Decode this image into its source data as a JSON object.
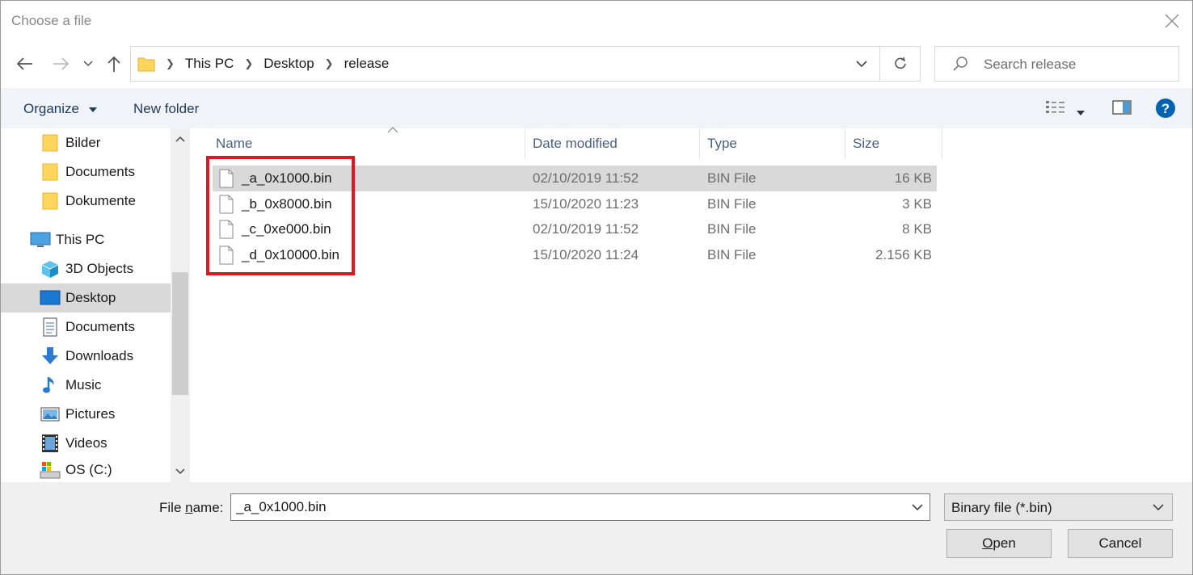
{
  "window": {
    "title": "Choose a file"
  },
  "breadcrumb": {
    "items": [
      "This PC",
      "Desktop",
      "release"
    ]
  },
  "search": {
    "placeholder": "Search release"
  },
  "toolbar": {
    "organize_label": "Organize",
    "new_folder_label": "New folder"
  },
  "sidebar": {
    "items": [
      {
        "label": "Bilder",
        "icon": "folder-icon"
      },
      {
        "label": "Documents",
        "icon": "folder-icon"
      },
      {
        "label": "Dokumente",
        "icon": "folder-icon"
      },
      {
        "label": "This PC",
        "icon": "computer-icon"
      },
      {
        "label": "3D Objects",
        "icon": "cube-icon"
      },
      {
        "label": "Desktop",
        "icon": "desktop-icon",
        "selected": true
      },
      {
        "label": "Documents",
        "icon": "documents-icon"
      },
      {
        "label": "Downloads",
        "icon": "download-icon"
      },
      {
        "label": "Music",
        "icon": "music-icon"
      },
      {
        "label": "Pictures",
        "icon": "pictures-icon"
      },
      {
        "label": "Videos",
        "icon": "video-icon"
      },
      {
        "label": "OS (C:)",
        "icon": "drive-icon"
      }
    ]
  },
  "columns": {
    "name": "Name",
    "date": "Date modified",
    "type": "Type",
    "size": "Size"
  },
  "files": [
    {
      "name": "_a_0x1000.bin",
      "date": "02/10/2019 11:52",
      "type": "BIN File",
      "size": "16 KB",
      "selected": true
    },
    {
      "name": "_b_0x8000.bin",
      "date": "15/10/2020 11:23",
      "type": "BIN File",
      "size": "3 KB"
    },
    {
      "name": "_c_0xe000.bin",
      "date": "02/10/2019 11:52",
      "type": "BIN File",
      "size": "8 KB"
    },
    {
      "name": "_d_0x10000.bin",
      "date": "15/10/2020 11:24",
      "type": "BIN File",
      "size": "2.156 KB"
    }
  ],
  "footer": {
    "filename_label_prefix": "File ",
    "filename_label_accel": "n",
    "filename_label_suffix": "ame:",
    "filename_value": "_a_0x1000.bin",
    "filetype_value": "Binary file (*.bin)",
    "open_accel": "O",
    "open_rest": "pen",
    "cancel_label": "Cancel"
  },
  "colors": {
    "highlight": "#e3161f",
    "accent": "#0063b1",
    "selection": "#d9d9d9"
  }
}
